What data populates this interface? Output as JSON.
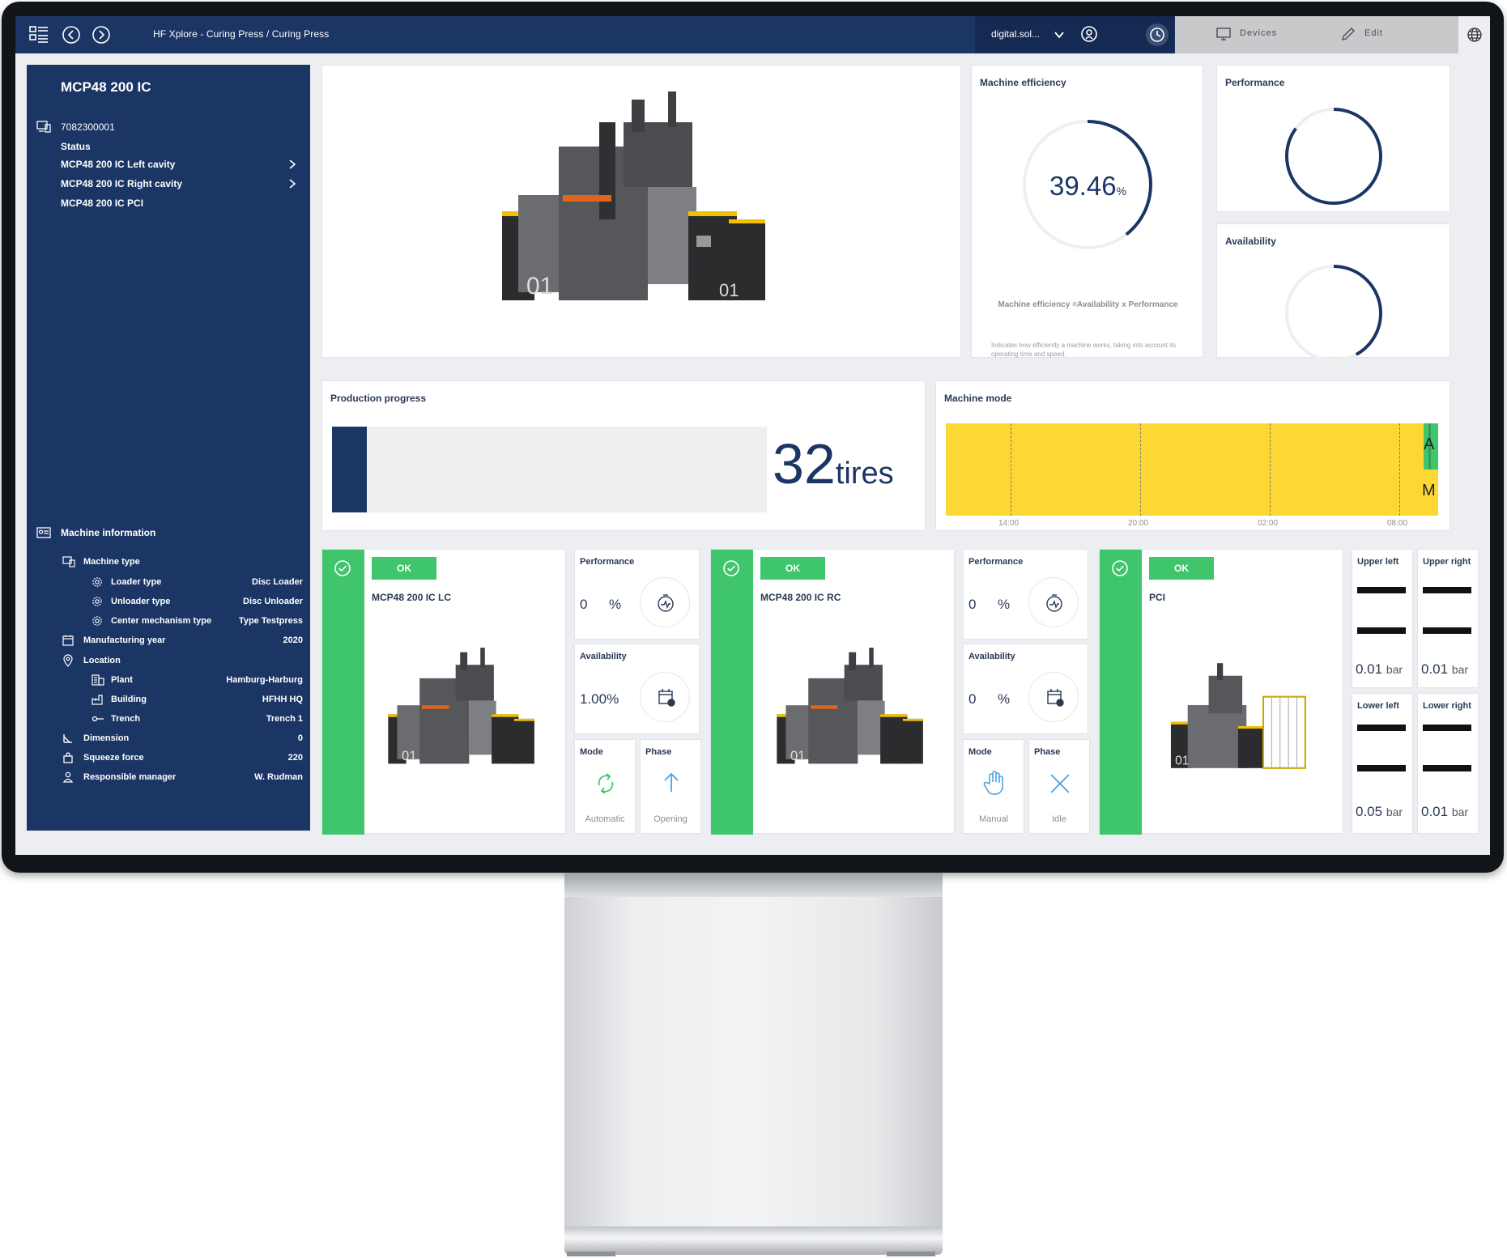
{
  "topbar": {
    "breadcrumb": "HF Xplore - Curing Press / Curing Press",
    "user": "digital.sol...",
    "devices_label": "Devices",
    "edit_label": "Edit"
  },
  "sidebar": {
    "title": "MCP48 200 IC",
    "serial": "7082300001",
    "status_label": "Status",
    "status_items": [
      {
        "label": "MCP48 200 IC Left cavity"
      },
      {
        "label": "MCP48 200 IC Right cavity"
      },
      {
        "label": "MCP48 200 IC PCI"
      }
    ],
    "machine_info_label": "Machine information",
    "machine_type_label": "Machine type",
    "info": [
      {
        "label": "Loader type",
        "value": "Disc Loader"
      },
      {
        "label": "Unloader type",
        "value": "Disc Unloader"
      },
      {
        "label": "Center mechanism type",
        "value": "Type Testpress"
      },
      {
        "label": "Manufacturing year",
        "value": "2020"
      },
      {
        "label": "Location",
        "value": ""
      },
      {
        "label": "Plant",
        "value": "Hamburg-Harburg"
      },
      {
        "label": "Building",
        "value": "HFHH HQ"
      },
      {
        "label": "Trench",
        "value": "Trench 1"
      },
      {
        "label": "Dimension",
        "value": "0"
      },
      {
        "label": "Squeeze force",
        "value": "220"
      },
      {
        "label": "Responsible manager",
        "value": "W. Rudman"
      }
    ]
  },
  "efficiency": {
    "title": "Machine efficiency",
    "value": "39.46",
    "unit": "%",
    "fraction": 0.3946,
    "formula": "Machine efficiency =Availability x Performance",
    "description": "Indicates how efficiently a machine works, taking into account its operating time and speed."
  },
  "performance": {
    "title": "Performance",
    "fraction": 0.85
  },
  "availability": {
    "title": "Availability",
    "fraction": 0.42
  },
  "production": {
    "title": "Production progress",
    "value": "32",
    "unit": "tires",
    "fraction": 0.08
  },
  "machine_mode": {
    "title": "Machine mode",
    "mode_a": "A",
    "mode_m": "M",
    "ticks": [
      "14:00",
      "20:00",
      "02:00",
      "08:00"
    ],
    "colors": {
      "manual": "#fdd835",
      "auto": "#3fc56c"
    }
  },
  "units": [
    {
      "status": "OK",
      "name": "MCP48 200 IC LC",
      "performance_label": "Performance",
      "performance_value": "0",
      "performance_unit": "%",
      "availability_label": "Availability",
      "availability_value": "1.00%",
      "mode_label": "Mode",
      "mode_value": "Automatic",
      "phase_label": "Phase",
      "phase_value": "Opening"
    },
    {
      "status": "OK",
      "name": "MCP48 200 IC RC",
      "performance_label": "Performance",
      "performance_value": "0",
      "performance_unit": "%",
      "availability_label": "Availability",
      "availability_value": "0",
      "availability_unit": "%",
      "mode_label": "Mode",
      "mode_value": "Manual",
      "phase_label": "Phase",
      "phase_value": "Idle"
    }
  ],
  "pci": {
    "status": "OK",
    "name": "PCI",
    "pressures": [
      {
        "label": "Upper left",
        "value": "0.01",
        "unit": "bar"
      },
      {
        "label": "Upper right",
        "value": "0.01",
        "unit": "bar"
      },
      {
        "label": "Lower left",
        "value": "0.05",
        "unit": "bar"
      },
      {
        "label": "Lower right",
        "value": "0.01",
        "unit": "bar"
      }
    ]
  }
}
